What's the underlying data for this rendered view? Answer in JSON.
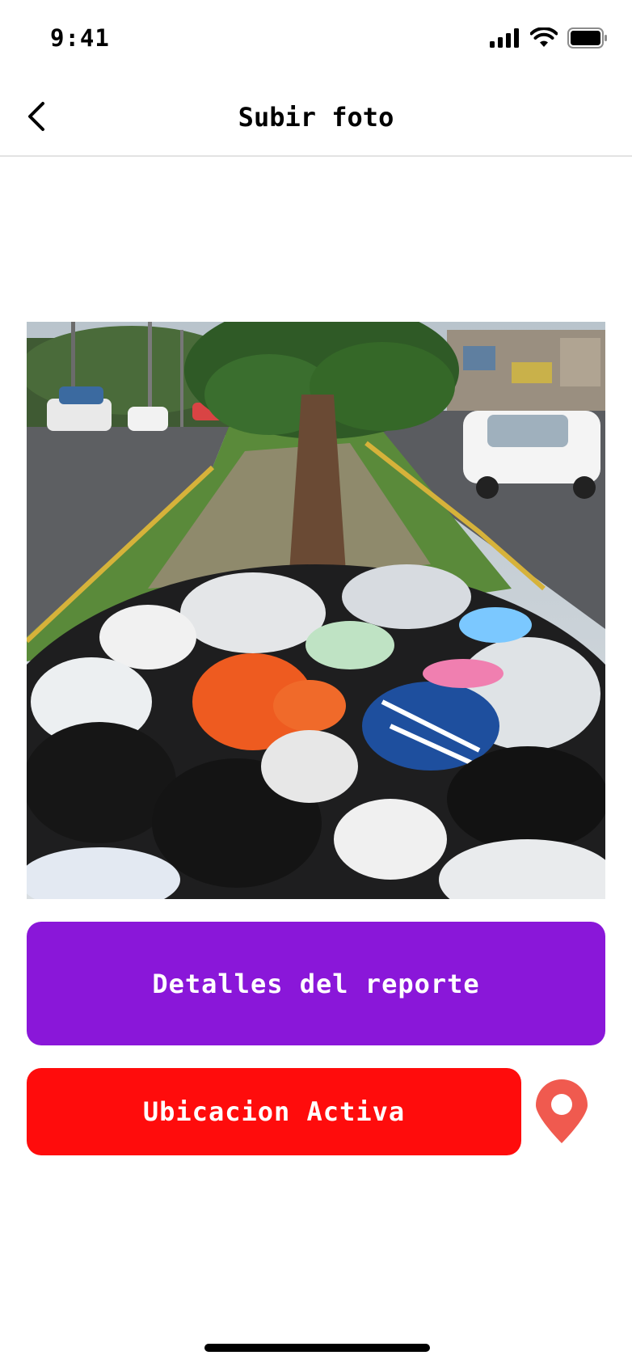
{
  "status_bar": {
    "time": "9:41",
    "icons": [
      "signal-icon",
      "wifi-icon",
      "battery-icon"
    ]
  },
  "nav": {
    "title": "Subir foto",
    "back_icon": "chevron-left-icon"
  },
  "photo": {
    "subject": "pile of garbage bags on a street median",
    "aria_label": "Foto del reporte"
  },
  "buttons": {
    "details_label": "Detalles del reporte",
    "location_label": "Ubicacion Activa"
  },
  "location_pin": {
    "icon": "location-pin-icon",
    "color": "#F05A4F"
  },
  "colors": {
    "details_button": "#8A17D9",
    "location_button": "#FF0C0C"
  }
}
